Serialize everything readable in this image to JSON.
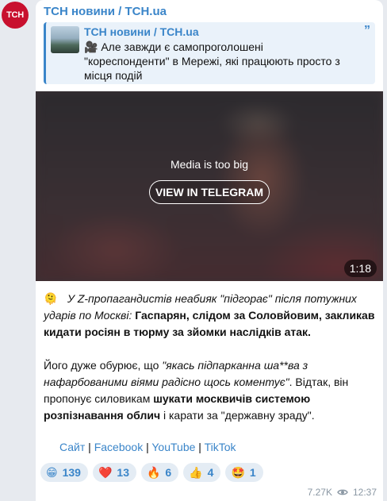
{
  "avatar": {
    "text": "ТСН"
  },
  "channel": {
    "name": "ТСН новини / ТСН.ua"
  },
  "quote": {
    "title": "ТСН новини / ТСН.ua",
    "mark": "”",
    "text": "🎥 Але завжди є самопроголошені \"кореспонденти\" в Мережі, які працюють просто з місця подій"
  },
  "media": {
    "label": "Media is too big",
    "button": "VIEW IN TELEGRAM",
    "duration": "1:18"
  },
  "message": {
    "p1_emoji": "🫠",
    "p1_italic": "У Z-пропагандистів неабияк \"підгорає\" після потужних ударів по Москві:",
    "p1_bold": "Гаспарян, слідом за Соловйовим, закликав кидати росіян в тюрму за зйомки наслідків атак.",
    "p2_a": "Його дуже обурює, що ",
    "p2_italic": "\"якась підпарканна ша**ва з нафарбованими віями радісно щось коментує\"",
    "p2_b": ". Відтак, він пропонує силовикам ",
    "p2_bold": "шукати москвичів системою розпізнавання облич",
    "p2_c": " і карати за \"державну зраду\"."
  },
  "links": {
    "site": "Сайт",
    "sep": " | ",
    "facebook": "Facebook",
    "youtube": "YouTube",
    "tiktok": "TikTok"
  },
  "reactions": [
    {
      "emoji": "😁",
      "count": "139"
    },
    {
      "emoji": "❤️",
      "count": "13"
    },
    {
      "emoji": "🔥",
      "count": "6"
    },
    {
      "emoji": "👍",
      "count": "4"
    },
    {
      "emoji": "🤩",
      "count": "1"
    }
  ],
  "meta": {
    "views": "7.27K",
    "time": "12:37"
  },
  "colors": {
    "accent": "#3a85c9",
    "avatar_bg": "#c8102e",
    "chat_bg": "#e7eaef"
  }
}
